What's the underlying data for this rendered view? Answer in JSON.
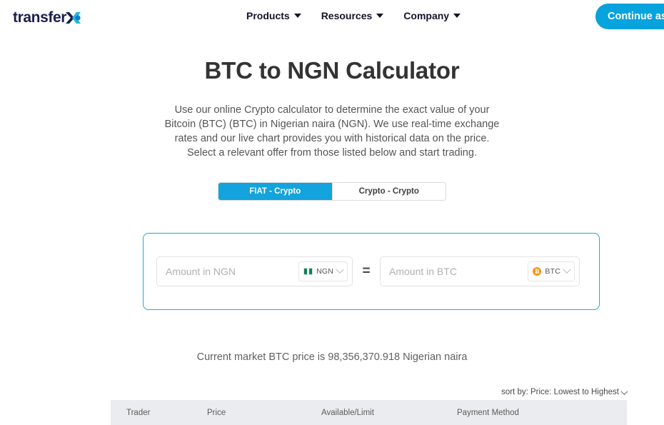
{
  "header": {
    "logo_text": "transfer",
    "logo_mark": "x-o-logomark",
    "nav": [
      {
        "label": "Products"
      },
      {
        "label": "Resources"
      },
      {
        "label": "Company"
      }
    ],
    "continue_button": "Continue as",
    "accent_color": "#06a3dd"
  },
  "main": {
    "title": "BTC to NGN Calculator",
    "description": "Use our online Crypto calculator to determine the exact value of your Bitcoin (BTC) (BTC) in Nigerian naira (NGN). We use real-time exchange rates and our live chart provides you with historical data on the price. Select a relevant offer from those listed below and start trading.",
    "tabs": [
      {
        "label": "FIAT - Crypto",
        "active": true
      },
      {
        "label": "Crypto - Crypto",
        "active": false
      }
    ],
    "calculator": {
      "from": {
        "value": "",
        "placeholder": "Amount in NGN",
        "currency_code": "NGN",
        "currency_icon": "nigeria-flag-icon"
      },
      "operator": "=",
      "to": {
        "value": "",
        "placeholder": "Amount in BTC",
        "currency_code": "BTC",
        "currency_icon": "bitcoin-icon",
        "bitcoin_symbol": "Ƀ",
        "bitcoin_color": "#f7931a"
      },
      "border_color": "#21a7e0"
    },
    "market_price": "Current market BTC price is 98,356,370.918 Nigerian naira",
    "sort": {
      "label": "sort by: Price: Lowest to Highest"
    },
    "table": {
      "columns": [
        "Trader",
        "Price",
        "Available/Limit",
        "Payment Method"
      ],
      "rows": []
    }
  }
}
